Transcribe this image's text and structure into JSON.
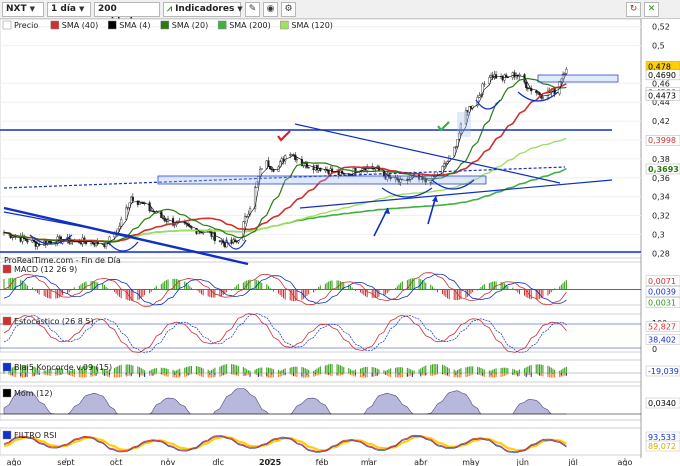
{
  "toolbar": {
    "symbol": "NXT",
    "period": "1 día",
    "units": "200 unidades",
    "indicators": "Indicadores"
  },
  "legend": [
    {
      "label": "Precio",
      "color": "#ffffff"
    },
    {
      "label": "SMA (40)",
      "color": "#d03030"
    },
    {
      "label": "SMA (4)",
      "color": "#000000"
    },
    {
      "label": "SMA (20)",
      "color": "#2a7a10"
    },
    {
      "label": "SMA (200)",
      "color": "#40b040"
    },
    {
      "label": "SMA (120)",
      "color": "#a0e060"
    }
  ],
  "watermark": "ProRealTime.com - Fin de Día",
  "price_axis": {
    "labels": [
      "0,52",
      "0,5",
      "0,46",
      "0,44",
      "0,42",
      "0,4",
      "0,38",
      "0,36",
      "0,34",
      "0,32",
      "0,3",
      "0,28"
    ],
    "ylim": [
      0.275,
      0.525
    ]
  },
  "price_tags": [
    {
      "text": "0,478",
      "bg": "#ffd000",
      "color": "#000000",
      "v": 0.478
    },
    {
      "text": "0,4690",
      "bg": "#ffffff",
      "color": "#000000",
      "v": 0.469
    },
    {
      "text": "0,4506",
      "bg": "#ffffff",
      "color": "#2a7a10",
      "v": 0.4506
    },
    {
      "text": "0,4473",
      "bg": "#ffffff",
      "color": "#000000",
      "v": 0.4473
    },
    {
      "text": "0,3998",
      "bg": "#ffffff",
      "color": "#d03030",
      "v": 0.3998
    },
    {
      "text": "0,3693",
      "bg": "#ffffff",
      "color": "#2a7a10",
      "v": 0.3693
    }
  ],
  "months": [
    "ago",
    "sept",
    "oct",
    "nov",
    "dic",
    "2025",
    "feb",
    "mar",
    "abr",
    "may",
    "jun",
    "jul",
    "ago"
  ],
  "chart_data": {
    "type": "candlestick",
    "x_start": "2024-07-26",
    "x_end": "2025-08-10",
    "close_approx": [
      [
        "2024-07-26",
        0.302
      ],
      [
        "2024-08-05",
        0.296
      ],
      [
        "2024-08-15",
        0.29
      ],
      [
        "2024-08-25",
        0.294
      ],
      [
        "2024-09-05",
        0.293
      ],
      [
        "2024-09-15",
        0.292
      ],
      [
        "2024-09-25",
        0.29
      ],
      [
        "2024-10-02",
        0.305
      ],
      [
        "2024-10-10",
        0.34
      ],
      [
        "2024-10-18",
        0.33
      ],
      [
        "2024-10-28",
        0.318
      ],
      [
        "2024-11-05",
        0.312
      ],
      [
        "2024-11-15",
        0.306
      ],
      [
        "2024-11-25",
        0.302
      ],
      [
        "2024-12-05",
        0.29
      ],
      [
        "2024-12-12",
        0.292
      ],
      [
        "2024-12-20",
        0.33
      ],
      [
        "2024-12-28",
        0.378
      ],
      [
        "2025-01-05",
        0.368
      ],
      [
        "2025-01-12",
        0.39
      ],
      [
        "2025-01-20",
        0.375
      ],
      [
        "2025-01-28",
        0.372
      ],
      [
        "2025-02-05",
        0.368
      ],
      [
        "2025-02-15",
        0.362
      ],
      [
        "2025-02-25",
        0.372
      ],
      [
        "2025-03-05",
        0.37
      ],
      [
        "2025-03-12",
        0.36
      ],
      [
        "2025-03-20",
        0.355
      ],
      [
        "2025-03-28",
        0.36
      ],
      [
        "2025-04-05",
        0.355
      ],
      [
        "2025-04-12",
        0.365
      ],
      [
        "2025-04-20",
        0.385
      ],
      [
        "2025-04-28",
        0.43
      ],
      [
        "2025-05-05",
        0.445
      ],
      [
        "2025-05-12",
        0.47
      ],
      [
        "2025-05-20",
        0.465
      ],
      [
        "2025-05-28",
        0.47
      ],
      [
        "2025-06-05",
        0.455
      ],
      [
        "2025-06-12",
        0.448
      ],
      [
        "2025-06-20",
        0.452
      ],
      [
        "2025-06-27",
        0.478
      ]
    ],
    "sma": {
      "SMA (40)": 0.3998,
      "SMA (20)": 0.4506,
      "SMA (4)": 0.469,
      "SMA (200)": 0.3693
    },
    "subpanels": [
      {
        "name": "MACD (12 26 9)",
        "tags": [
          {
            "text": "0,0071",
            "color": "#d03030",
            "v": 0.0071
          },
          {
            "text": "0,0039",
            "color": "#1030d0",
            "v": 0.0039
          },
          {
            "text": "0,0031",
            "color": "#2a9a10",
            "v": 0.0031
          }
        ]
      },
      {
        "name": "Estocástico (26 8 5)",
        "axis": [
          "100",
          "0"
        ],
        "tags": [
          {
            "text": "52,827",
            "color": "#d03030",
            "v": 52.827
          },
          {
            "text": "38,402",
            "color": "#1030d0",
            "v": 38.402
          }
        ]
      },
      {
        "name": "Blai5 Koncorde v.09 (15)",
        "tags": [
          {
            "text": "-19,039",
            "color": "#1030d0",
            "v": -19.039
          }
        ]
      },
      {
        "name": "Mom (12)",
        "tags": [
          {
            "text": "0,0340",
            "color": "#000000",
            "v": 0.034
          }
        ]
      },
      {
        "name": "FILTRO RSI",
        "tags": [
          {
            "text": "93,533",
            "color": "#1030d0",
            "v": 93.533
          },
          {
            "text": "89,072",
            "color": "#d0b000",
            "v": 89.072
          }
        ]
      }
    ]
  }
}
